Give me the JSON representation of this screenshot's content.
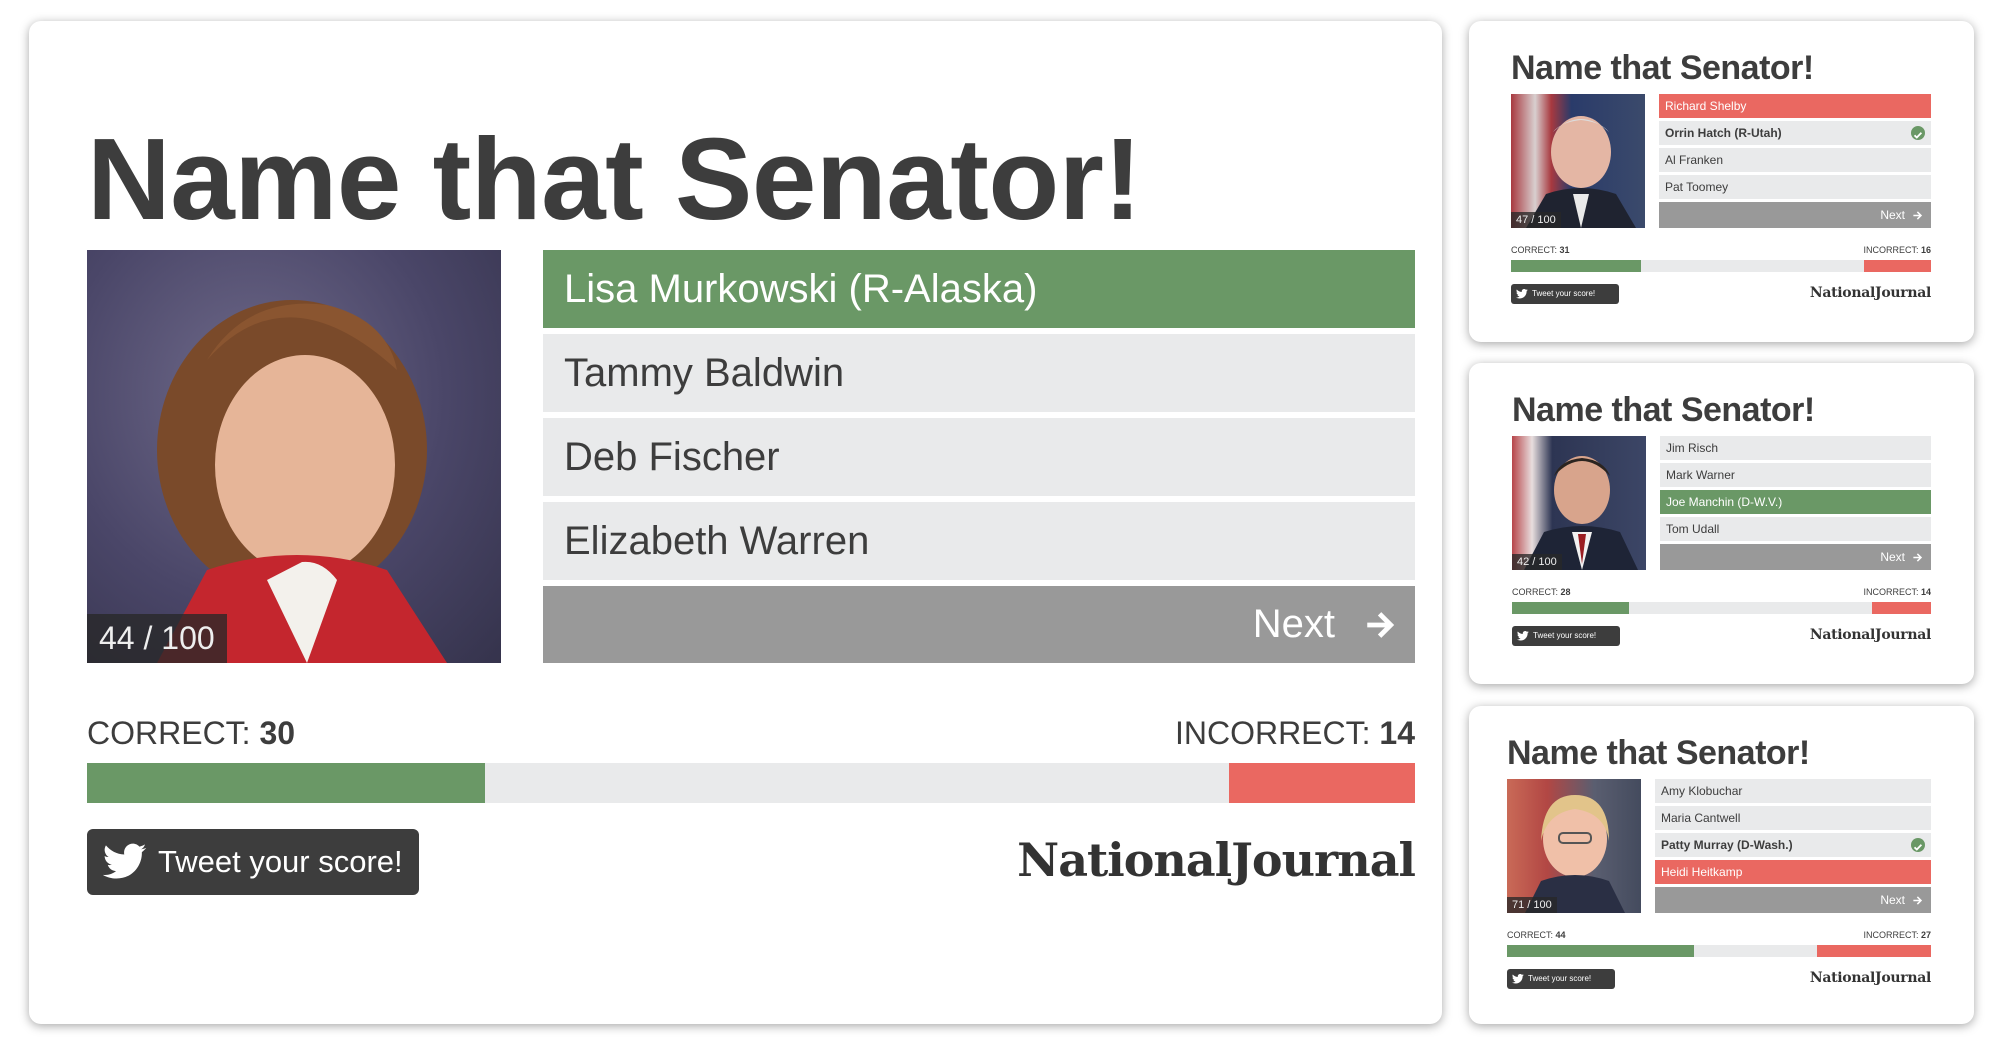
{
  "main": {
    "title": "Name that Senator!",
    "progress": "44 / 100",
    "options": [
      {
        "label": "Lisa Murkowski (R-Alaska)",
        "state": "correct"
      },
      {
        "label": "Tammy Baldwin",
        "state": "default"
      },
      {
        "label": "Deb Fischer",
        "state": "default"
      },
      {
        "label": "Elizabeth Warren",
        "state": "default"
      }
    ],
    "next_label": "Next",
    "correct_label": "CORRECT:",
    "correct_value": "30",
    "incorrect_label": "INCORRECT:",
    "incorrect_value": "14",
    "correct_fraction": 0.3,
    "incorrect_fraction": 0.14,
    "tweet_label": "Tweet your score!",
    "logo_text": "NationalJournal"
  },
  "cards": [
    {
      "title": "Name that Senator!",
      "progress": "47 / 100",
      "options": [
        {
          "label": "Richard Shelby",
          "state": "wrong"
        },
        {
          "label": "Orrin Hatch (R-Utah)",
          "state": "answer"
        },
        {
          "label": "Al Franken",
          "state": "default"
        },
        {
          "label": "Pat Toomey",
          "state": "default"
        }
      ],
      "next_label": "Next",
      "correct_label": "CORRECT:",
      "correct_value": "31",
      "incorrect_label": "INCORRECT:",
      "incorrect_value": "16",
      "tweet_label": "Tweet your score!",
      "logo_text": "NationalJournal"
    },
    {
      "title": "Name that Senator!",
      "progress": "42 / 100",
      "options": [
        {
          "label": "Jim Risch",
          "state": "default"
        },
        {
          "label": "Mark Warner",
          "state": "default"
        },
        {
          "label": "Joe Manchin (D-W.V.)",
          "state": "correct"
        },
        {
          "label": "Tom Udall",
          "state": "default"
        }
      ],
      "next_label": "Next",
      "correct_label": "CORRECT:",
      "correct_value": "28",
      "incorrect_label": "INCORRECT:",
      "incorrect_value": "14",
      "tweet_label": "Tweet your score!",
      "logo_text": "NationalJournal"
    },
    {
      "title": "Name that Senator!",
      "progress": "71 / 100",
      "options": [
        {
          "label": "Amy Klobuchar",
          "state": "default"
        },
        {
          "label": "Maria Cantwell",
          "state": "default"
        },
        {
          "label": "Patty Murray (D-Wash.)",
          "state": "answer"
        },
        {
          "label": "Heidi Heitkamp",
          "state": "wrong"
        }
      ],
      "next_label": "Next",
      "correct_label": "CORRECT:",
      "correct_value": "44",
      "incorrect_label": "INCORRECT:",
      "incorrect_value": "27",
      "tweet_label": "Tweet your score!",
      "logo_text": "NationalJournal"
    }
  ],
  "colors": {
    "correct": "#6a9866",
    "incorrect": "#ea6861",
    "option_bg": "#e9eaeb",
    "next_bg": "#999999",
    "text": "#3d3d3d"
  },
  "icons": {
    "next": "arrow-right-icon",
    "tweet": "twitter-bird-icon",
    "answer": "check-circle-icon"
  }
}
